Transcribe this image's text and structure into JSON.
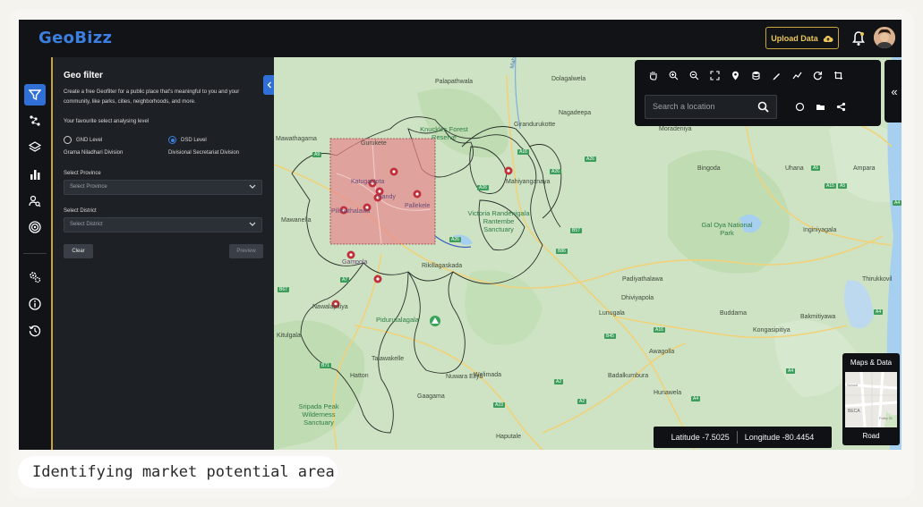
{
  "app": {
    "logo": "GeoBizz",
    "upload_label": "Upload Data"
  },
  "panel": {
    "title": "Geo filter",
    "description": "Create a free Geofilter for a public place that's meaningful to you and your community, like parks, cities, neighborhoods, and more.",
    "level_heading": "Your favourite select analysing level",
    "levels": [
      {
        "label": "GND Level",
        "sublabel": "Grama Niladhari Division",
        "selected": false
      },
      {
        "label": "DSD Level",
        "sublabel": "Divisional Secretariat Division",
        "selected": true
      }
    ],
    "province_label": "Select Province",
    "province_placeholder": "Select Province",
    "district_label": "Select District",
    "district_placeholder": "Select District",
    "clear_label": "Clear",
    "preview_label": "Preview"
  },
  "map": {
    "search_placeholder": "Search a location",
    "latitude": "Latitude -7.5025",
    "longitude": "Longitude -80.4454",
    "maps_data_title": "Maps & Data",
    "maps_data_mode": "Road",
    "thumb_labels": [
      "School",
      "BECA",
      "Foley St"
    ],
    "labels": {
      "gangu": "Mahaweli Ganga",
      "palapathwala": "Palapathwala",
      "dolagalwela": "Dolagalwela",
      "nagadeepa": "Nagadeepa",
      "mawatagama": "Mawathagama",
      "kurukete": "Gurukete",
      "knuckles": "Knuckles Forest Reserve",
      "girandurukotte": "Girandurukotte",
      "moradeniya": "Moradeniya",
      "mahiyanganaya": "Mahiyanganaya",
      "bingoda": "Bingoda",
      "uhana": "Uhana",
      "ampara": "Ampara",
      "mawanella": "Mawanella",
      "gal_oya": "Gal Oya National Park",
      "victoria": "Victoria Randenigala Rantembe Sanctuary",
      "rikillagaskada": "Rikillagaskada",
      "inginiyagala": "Inginiyagala",
      "thirukkovil": "Thirukkovil",
      "nawalapitiya": "Nawalapitiya",
      "pidurutalagala": "Pidurutalagala",
      "padiyatalawa": "Padiyathalawa",
      "lunugala": "Lunugala",
      "dhiviyapola": "Dhiviyapola",
      "buddama": "Buddama",
      "bakmitiyawa": "Bakmitiyawa",
      "kitulgala": "Kitulgala",
      "kongasipitiya": "Kongasipitiya",
      "talawakelle": "Talawakelle",
      "nuwara_eliya": "Nuwara Eliya",
      "awagolla": "Awagolla",
      "hatton": "Hatton",
      "welimada": "Welimada",
      "badalkumbura": "Badalkumbura",
      "ganagama": "Gaagama",
      "hunawela": "Hunawela",
      "sripada": "Sripada Peak Wilderness Sanctuary",
      "haputale": "Haputale",
      "kandy": "Kandy",
      "pallekele": "Pallekele",
      "gampola": "Gampola",
      "pilimatalawa": "Pilimathalawa",
      "katugastota": "Katugastota"
    },
    "highways": [
      "A9",
      "A26",
      "A26",
      "A26",
      "A16",
      "A5",
      "B57",
      "B86",
      "A5",
      "A4",
      "A4",
      "A15",
      "B67",
      "B71",
      "A7",
      "A4",
      "B45",
      "A16",
      "A2",
      "A23",
      "A2",
      "A4",
      "A26"
    ]
  },
  "caption": "Identifying market potential area",
  "colors": {
    "accent": "#2f6fd6",
    "gold": "#c9a43a",
    "selection": "#e8868c"
  }
}
